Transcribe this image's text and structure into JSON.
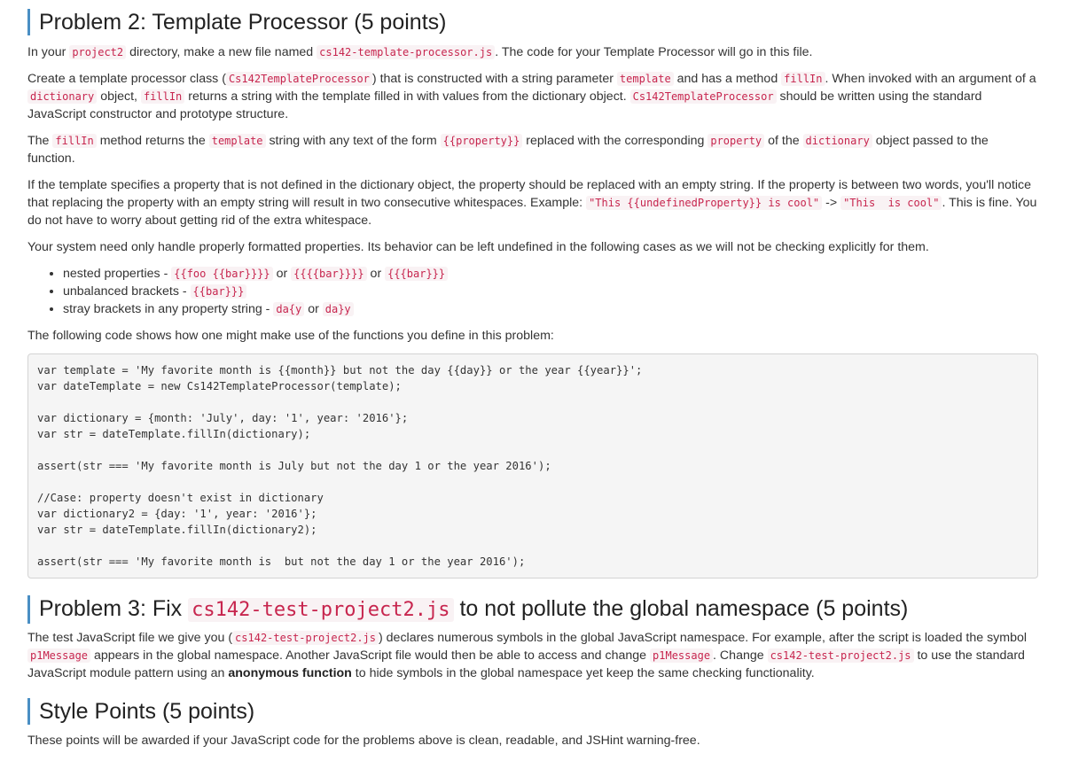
{
  "problem2": {
    "heading": "Problem 2: Template Processor (5 points)",
    "p1": {
      "t1": "In your ",
      "c1": "project2",
      "t2": " directory, make a new file named ",
      "c2": "cs142-template-processor.js",
      "t3": ". The code for your Template Processor will go in this file."
    },
    "p2": {
      "t1": "Create a template processor class (",
      "c1": "Cs142TemplateProcessor",
      "t2": ") that is constructed with a string parameter ",
      "c2": "template",
      "t3": " and has a method ",
      "c3": "fillIn",
      "t4": ". When invoked with an argument of a ",
      "c4": "dictionary",
      "t5": " object, ",
      "c5": "fillIn",
      "t6": " returns a string with the template filled in with values from the dictionary object. ",
      "c6": "Cs142TemplateProcessor",
      "t7": " should be written using the standard JavaScript constructor and prototype structure."
    },
    "p3": {
      "t1": "The ",
      "c1": "fillIn",
      "t2": " method returns the ",
      "c2": "template",
      "t3": " string with any text of the form ",
      "c3": "{{property}}",
      "t4": " replaced with the corresponding ",
      "c4": "property",
      "t5": " of the ",
      "c5": "dictionary",
      "t6": " object passed to the function."
    },
    "p4": {
      "t1": "If the template specifies a property that is not defined in the dictionary object, the property should be replaced with an empty string. If the property is between two words, you'll notice that replacing the property with an empty string will result in two consecutive whitespaces. Example: ",
      "c1": "\"This {{undefinedProperty}} is cool\"",
      "t2": " -> ",
      "c2": "\"This  is cool\"",
      "t3": ". This is fine. You do not have to worry about getting rid of the extra whitespace."
    },
    "p5": "Your system need only handle properly formatted properties. Its behavior can be left undefined in the following cases as we will not be checking explicitly for them.",
    "bullets": {
      "b1": {
        "t1": "nested properties - ",
        "c1": "{{foo {{bar}}}}",
        "t2": " or ",
        "c2": "{{{{bar}}}}",
        "t3": " or ",
        "c3": "{{{bar}}}"
      },
      "b2": {
        "t1": "unbalanced brackets - ",
        "c1": "{{bar}}}"
      },
      "b3": {
        "t1": "stray brackets in any property string - ",
        "c1": "da{y",
        "t2": " or ",
        "c2": "da}y"
      }
    },
    "p6": "The following code shows how one might make use of the functions you define in this problem:",
    "code": "var template = 'My favorite month is {{month}} but not the day {{day}} or the year {{year}}';\nvar dateTemplate = new Cs142TemplateProcessor(template);\n\nvar dictionary = {month: 'July', day: '1', year: '2016'};\nvar str = dateTemplate.fillIn(dictionary);\n\nassert(str === 'My favorite month is July but not the day 1 or the year 2016');\n\n//Case: property doesn't exist in dictionary\nvar dictionary2 = {day: '1', year: '2016'};\nvar str = dateTemplate.fillIn(dictionary2);\n\nassert(str === 'My favorite month is  but not the day 1 or the year 2016');"
  },
  "problem3": {
    "heading_pre": "Problem 3: Fix ",
    "heading_code": "cs142-test-project2.js",
    "heading_post": " to not pollute the global namespace (5 points)",
    "p1": {
      "t1": "The test JavaScript file we give you (",
      "c1": "cs142-test-project2.js",
      "t2": ") declares numerous symbols in the global JavaScript namespace. For example, after the script is loaded the symbol ",
      "c2": "p1Message",
      "t3": " appears in the global namespace. Another JavaScript file would then be able to access and change ",
      "c3": "p1Message",
      "t4": ". Change ",
      "c4": "cs142-test-project2.js",
      "t5": " to use the standard JavaScript module pattern using an ",
      "b1": "anonymous function",
      "t6": " to hide symbols in the global namespace yet keep the same checking functionality."
    }
  },
  "style": {
    "heading": "Style Points (5 points)",
    "p1": "These points will be awarded if your JavaScript code for the problems above is clean, readable, and JSHint warning-free."
  }
}
